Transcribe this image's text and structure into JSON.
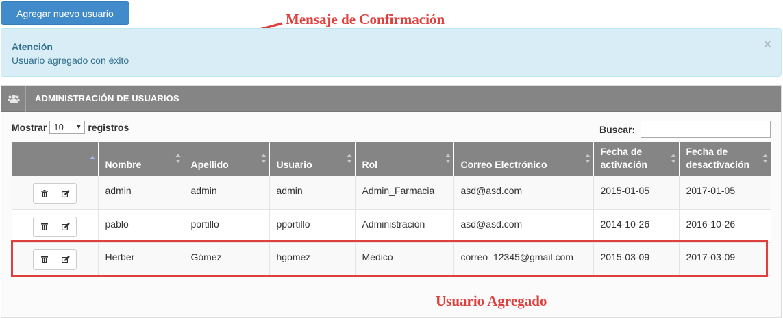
{
  "add_button_label": "Agregar nuevo usuario",
  "annotations": {
    "confirmation": "Mensaje de Confirmación",
    "added": "Usuario Agregado"
  },
  "alert": {
    "title": "Atención",
    "message": "Usuario agregado con éxito",
    "close": "×"
  },
  "panel": {
    "icon": "users-icon",
    "title": "ADMINISTRACIÓN DE USUARIOS"
  },
  "length_control": {
    "prefix": "Mostrar",
    "selected": "10",
    "suffix": "registros"
  },
  "search": {
    "label": "Buscar:",
    "value": ""
  },
  "table": {
    "columns": [
      {
        "label": ""
      },
      {
        "label": "Nombre"
      },
      {
        "label": "Apellido"
      },
      {
        "label": "Usuario"
      },
      {
        "label": "Rol"
      },
      {
        "label": "Correo Electrónico"
      },
      {
        "label": "Fecha de activación"
      },
      {
        "label": "Fecha de desactivación"
      }
    ],
    "rows": [
      {
        "nombre": "admin",
        "apellido": "admin",
        "usuario": "admin",
        "rol": "Admin_Farmacia",
        "correo": "asd@asd.com",
        "activacion": "2015-01-05",
        "desactivacion": "2017-01-05"
      },
      {
        "nombre": "pablo",
        "apellido": "portillo",
        "usuario": "pportillo",
        "rol": "Administración",
        "correo": "asd@asd.com",
        "activacion": "2014-10-26",
        "desactivacion": "2016-10-26"
      },
      {
        "nombre": "Herber",
        "apellido": "Gómez",
        "usuario": "hgomez",
        "rol": "Medico",
        "correo": "correo_12345@gmail.com",
        "activacion": "2015-03-09",
        "desactivacion": "2017-03-09"
      }
    ],
    "action_icons": [
      "trash-icon",
      "edit-icon"
    ]
  },
  "colors": {
    "primary": "#428bca",
    "alert_bg": "#d9edf7",
    "alert_text": "#31708f",
    "header_gray": "#858585",
    "annotation_red": "#e0403d"
  }
}
